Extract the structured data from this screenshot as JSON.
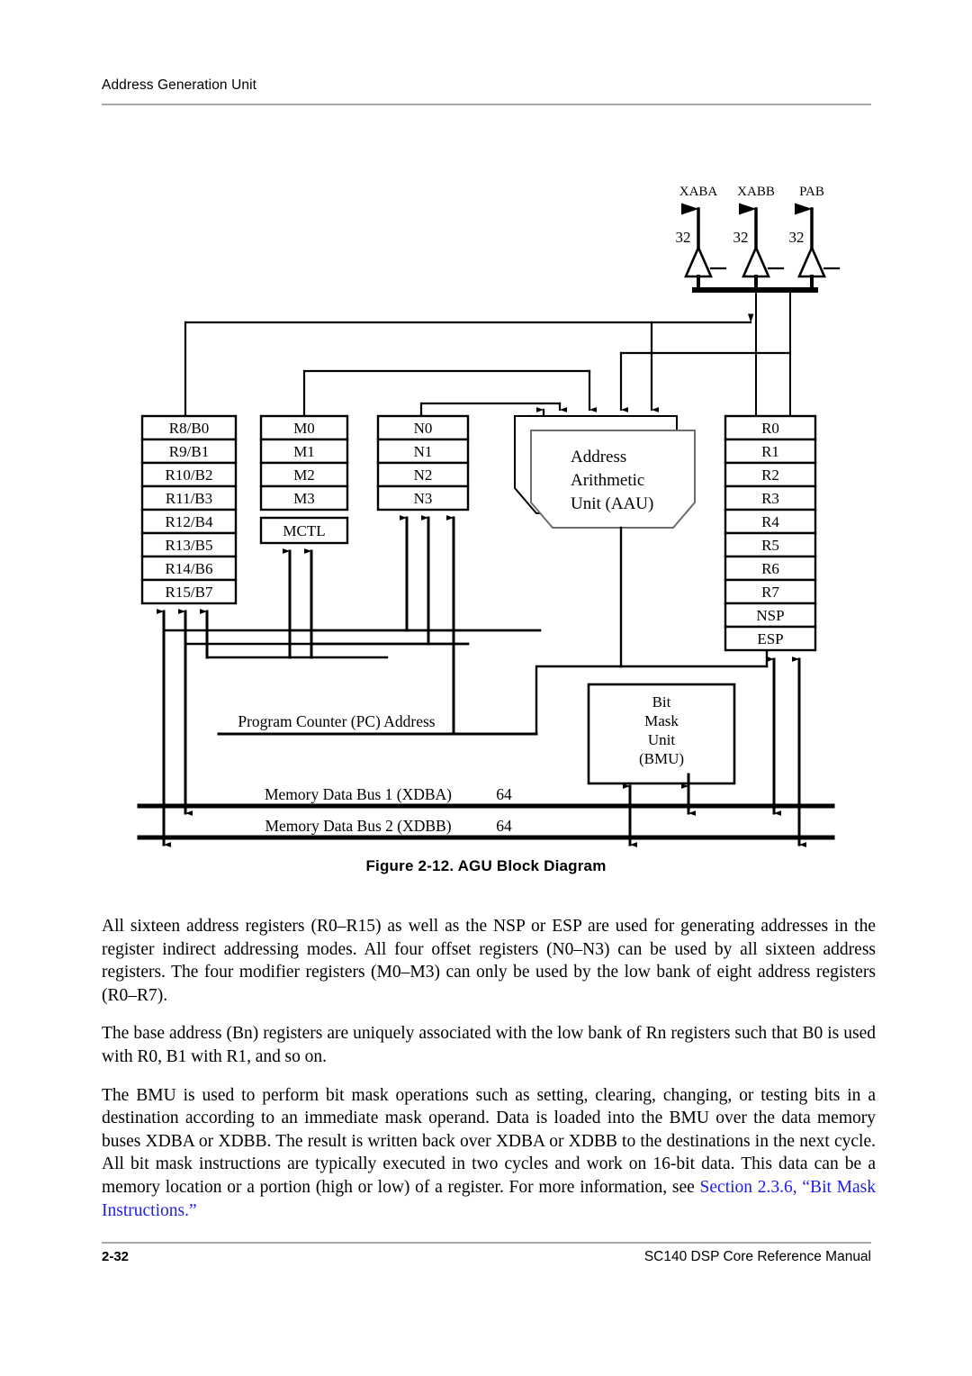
{
  "running_head": "Address Generation Unit",
  "figure": {
    "caption": "Figure 2-12.   AGU Block Diagram",
    "buses_top": [
      {
        "name": "XABA",
        "width": "32"
      },
      {
        "name": "XABB",
        "width": "32"
      },
      {
        "name": "PAB",
        "width": "32"
      }
    ],
    "register_bank_high": [
      "R8/B0",
      "R9/B1",
      "R10/B2",
      "R11/B3",
      "R12/B4",
      "R13/B5",
      "R14/B6",
      "R15/B7"
    ],
    "modifier_registers": [
      "M0",
      "M1",
      "M2",
      "M3"
    ],
    "modifier_control": "MCTL",
    "offset_registers": [
      "N0",
      "N1",
      "N2",
      "N3"
    ],
    "register_bank_low": [
      "R0",
      "R1",
      "R2",
      "R3",
      "R4",
      "R5",
      "R6",
      "R7",
      "NSP",
      "ESP"
    ],
    "aau_label_lines": [
      "Address",
      "Arithmetic",
      "Unit (AAU)"
    ],
    "bmu_label_lines": [
      "Bit",
      "Mask",
      "Unit",
      "(BMU)"
    ],
    "pc_bus_label": "Program Counter (PC) Address",
    "data_bus_1": {
      "label": "Memory Data Bus 1 (XDBA)",
      "width": "64"
    },
    "data_bus_2": {
      "label": "Memory Data Bus 2 (XDBB)",
      "width": "64"
    }
  },
  "paragraphs": {
    "p1": "All sixteen address registers (R0–R15) as well as the NSP or ESP are used for generating addresses in the register indirect addressing modes. All four offset registers (N0–N3) can be used by all sixteen address registers. The four modifier registers (M0–M3) can only be used by the low bank of eight address registers (R0–R7).",
    "p2": "The base address (Bn) registers are uniquely associated with the low bank of Rn registers such that B0 is used with R0, B1 with R1, and so on.",
    "p3_before": "The BMU is used to perform bit mask operations such as setting, clearing, changing, or testing bits in a destination according to an immediate mask operand. Data is loaded into the BMU over the data memory buses XDBA or XDBB. The result is written back over XDBA or XDBB to the destinations in the next cycle. All bit mask instructions are typically executed in two cycles and work on 16-bit data. This data can be a memory location or a portion (high or low) of a register. For more information, see ",
    "p3_link": "Section 2.3.6, “Bit Mask Instructions.”"
  },
  "footer": {
    "page_number": "2-32",
    "manual_title": "SC140 DSP Core Reference Manual"
  },
  "colors": {
    "link": "#1d1df0",
    "rule": "#a8a8a8",
    "aau_front_stroke": "#6d6d6d"
  }
}
